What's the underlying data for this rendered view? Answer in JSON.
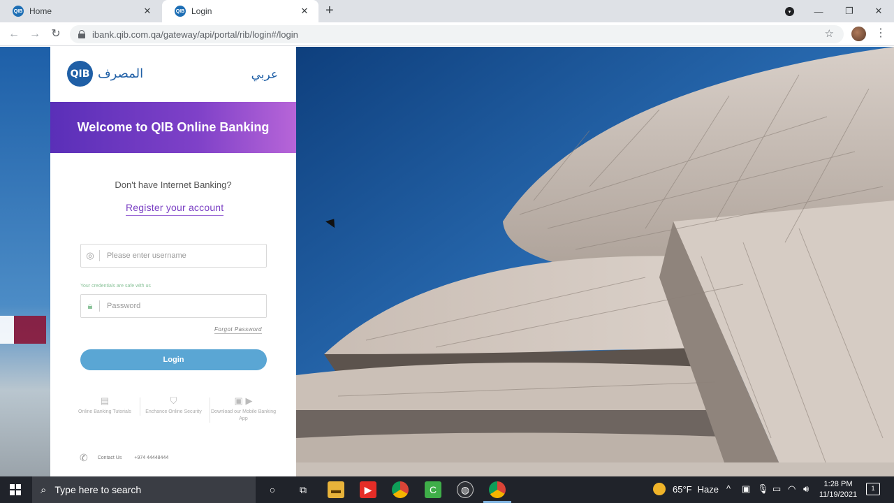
{
  "browser": {
    "tabs": [
      {
        "label": "Home"
      },
      {
        "label": "Login"
      }
    ],
    "url": "ibank.qib.com.qa/gateway/api/portal/rib/login#/login",
    "favicon_text": "QIB"
  },
  "page": {
    "logo_text": "QIB",
    "logo_arabic": "المصرف",
    "language_link": "عربي",
    "welcome_banner": "Welcome to QIB Online Banking",
    "no_internet_banking": "Don't have Internet Banking?",
    "register_link": "Register your account",
    "username_placeholder": "Please enter username",
    "credentials_note": "Your credentials are safe with us",
    "password_placeholder": "Password",
    "forgot_password": "Forgot Password",
    "login_button": "Login",
    "quick_links": [
      {
        "label": "Online Banking Tutorials",
        "icon": "tutorial-icon"
      },
      {
        "label": "Enchance Online Security",
        "icon": "shield-icon"
      },
      {
        "label": "Download our Mobile Banking App",
        "icon": "app-store-icon"
      }
    ],
    "contact_label": "Contact Us",
    "contact_number": "+974 44448444"
  },
  "taskbar": {
    "search_placeholder": "Type here to search",
    "weather_temp": "65°F",
    "weather_desc": "Haze",
    "time": "1:28 PM",
    "date": "11/19/2021",
    "notification_count": "1"
  },
  "colors": {
    "banner_start": "#5a2fb8",
    "banner_end": "#b765d8",
    "brand_blue": "#1f5fa6",
    "login_button": "#5aa6d4",
    "register_link": "#7a3fc3"
  }
}
